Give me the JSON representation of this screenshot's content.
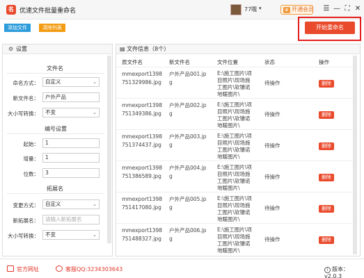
{
  "window": {
    "logo_char": "名",
    "title": "优速文件批量重命名",
    "user_name": "77哦",
    "user_caret": "▾",
    "vip_label": "开通会员",
    "vip_icon": "♛",
    "controls": [
      "☰",
      "—",
      "⛶",
      "✕"
    ]
  },
  "toolbar": {
    "add_label": "添加文件",
    "clear_label": "清除列表",
    "start_label": "开始重命名",
    "accent_color": "#ea4a2c"
  },
  "settings": {
    "title": "设置",
    "icon": "gear-icon",
    "filename_section": "文件名",
    "rename_mode_label": "命名方式：",
    "rename_mode_value": "自定义",
    "new_name_label": "新文件名：",
    "new_name_value": "户外产品",
    "case_label": "大小写转换：",
    "case_value": "不变",
    "number_section": "编号设置",
    "start_label": "起始：",
    "start_value": "1",
    "step_label": "增量：",
    "step_value": "1",
    "digits_label": "位数：",
    "digits_value": "3",
    "ext_section": "拓展名",
    "ext_mode_label": "变更方式：",
    "ext_mode_value": "自定义",
    "new_ext_label": "新拓展名：",
    "new_ext_placeholder": "请输入新拓展名",
    "ext_case_label": "大小写转换：",
    "ext_case_value": "不变"
  },
  "file_table": {
    "title": "文件信息（8个）",
    "headers": [
      "原文件名",
      "新文件名",
      "文件位置",
      "状态",
      "操作"
    ],
    "rows": [
      {
        "orig": [
          "mmexport1398",
          "751329986.jpg"
        ],
        "new": [
          "户外产品001.jp",
          "g"
        ],
        "loc": [
          "E:\\施工图片\\项",
          "目照片\\现场施",
          "工图片\\软镶诺",
          "地暖图片\\"
        ],
        "status": "待操作",
        "action": "删除"
      },
      {
        "orig": [
          "mmexport1398",
          "751349386.jpg"
        ],
        "new": [
          "户外产品002.jp",
          "g"
        ],
        "loc": [
          "E:\\施工图片\\项",
          "目照片\\现场施",
          "工图片\\软镶诺",
          "地暖图片\\"
        ],
        "status": "待操作",
        "action": "删除"
      },
      {
        "orig": [
          "mmexport1398",
          "751374437.jpg"
        ],
        "new": [
          "户外产品003.jp",
          "g"
        ],
        "loc": [
          "E:\\施工图片\\项",
          "目照片\\现场施",
          "工图片\\软镶诺",
          "地暖图片\\"
        ],
        "status": "待操作",
        "action": "删除"
      },
      {
        "orig": [
          "mmexport1398",
          "751386589.jpg"
        ],
        "new": [
          "户外产品004.jp",
          "g"
        ],
        "loc": [
          "E:\\施工图片\\项",
          "目照片\\现场施",
          "工图片\\软镶诺",
          "地暖图片\\"
        ],
        "status": "待操作",
        "action": "删除"
      },
      {
        "orig": [
          "mmexport1398",
          "751417080.jpg"
        ],
        "new": [
          "户外产品005.jp",
          "g"
        ],
        "loc": [
          "E:\\施工图片\\项",
          "目照片\\现场施",
          "工图片\\软镶诺",
          "地暖图片\\"
        ],
        "status": "待操作",
        "action": "删除"
      },
      {
        "orig": [
          "mmexport1398",
          "751488327.jpg"
        ],
        "new": [
          "户外产品006.jp",
          "g"
        ],
        "loc": [
          "E:\\施工图片\\项",
          "目照片\\现场施",
          "工图片\\软镶诺",
          "地暖图片\\"
        ],
        "status": "待操作",
        "action": "删除"
      }
    ]
  },
  "footer": {
    "website_label": "官方网址",
    "support_label": "客服QQ:3234303643",
    "version_label": "版本：v2.0.3"
  }
}
